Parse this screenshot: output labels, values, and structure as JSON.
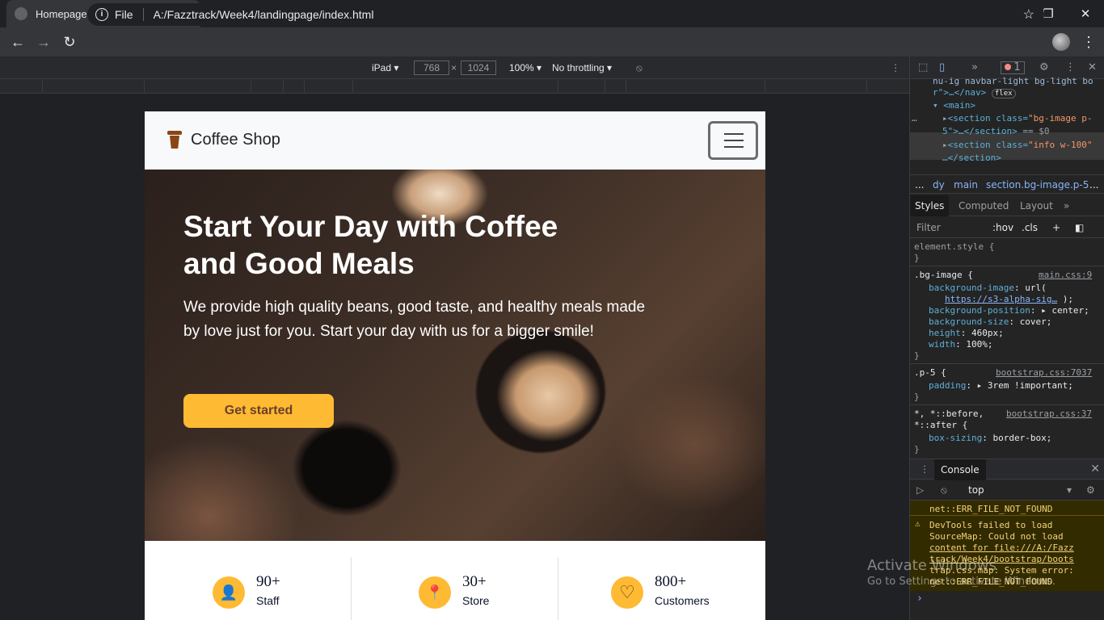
{
  "browser": {
    "tab_title": "Homepage",
    "tab_close": "✕",
    "new_tab": "+",
    "window_controls": [
      "—",
      "❐",
      "✕"
    ],
    "profile_dropdown": "▾",
    "file_label": "File",
    "url": "A:/Fazztrack/Week4/landingpage/index.html",
    "star": "☆",
    "menu": "⋮"
  },
  "device_toolbar": {
    "device": "iPad ▾",
    "width": "768",
    "times": "×",
    "height": "1024",
    "zoom": "100% ▾",
    "throttling": "No throttling ▾"
  },
  "site": {
    "brand": "Coffee Shop",
    "hero_title": "Start Your Day with Coffee and Good Meals",
    "hero_subtitle": "We provide high quality beans, good taste, and healthy meals made by love just for you. Start your day with us for a bigger smile!",
    "cta": "Get started",
    "stats": [
      {
        "icon": "person-icon",
        "glyph": "👤",
        "value": "90+",
        "label": "Staff"
      },
      {
        "icon": "location-pin-icon",
        "glyph": "📍",
        "value": "30+",
        "label": "Store"
      },
      {
        "icon": "heart-icon",
        "glyph": "♡",
        "value": "800+",
        "label": "Customers"
      }
    ],
    "accent": "#FFBA33",
    "brand_color": "#6A4029"
  },
  "devtools": {
    "error_count": "1",
    "elements": {
      "line1": "nu-ig navbar-light bg-light bo",
      "line2_a": "r\">…</nav>",
      "line2_badge": "flex",
      "line3": "<main>",
      "line4_a": "<section class=",
      "line4_b": "\"bg-image p-",
      "line5_a": "5\">…</section>",
      "line5_b": " == $0",
      "line6_a": "<section class=",
      "line6_b": "\"info w-100\"",
      "line7": "…</section>"
    },
    "breadcrumbs": [
      "...",
      "dy",
      "main",
      "section.bg-image.p-5",
      "..."
    ],
    "tabs": [
      "Styles",
      "Computed",
      "Layout",
      "»"
    ],
    "filter_placeholder": "Filter",
    "hov": ":hov",
    "cls": ".cls",
    "styles": {
      "element_style": "element.style {",
      "close": "}",
      "bg_selector": ".bg-image {",
      "bg_source": "main.css:9",
      "bg_image_prop": "background-image",
      "bg_image_val": ": url(",
      "bg_image_url": "https://s3-alpha-sig…",
      "bg_image_end": ");",
      "bg_pos_prop": "background-position",
      "bg_pos_val": ": ▸ center;",
      "bg_size_prop": "background-size",
      "bg_size_val": ": cover;",
      "height_prop": "height",
      "height_val": ": 460px;",
      "width_prop": "width",
      "width_val": ": 100%;",
      "p5_selector": ".p-5 {",
      "p5_source": "bootstrap.css:7037",
      "padding_prop": "padding",
      "padding_val": ": ▸ 3rem !important;",
      "univ_selector": "*, *::before,",
      "univ_selector2": "*::after {",
      "univ_source": "bootstrap.css:37",
      "box_prop": "box-sizing",
      "box_val": ": border-box;"
    },
    "console": {
      "tab": "Console",
      "context": "top",
      "err_tail": "net::ERR_FILE_NOT_FOUND",
      "warn_lines": [
        "DevTools failed to load",
        "SourceMap: Could not load",
        "content for file:///A:/Fazz",
        "track/Week4/bootstrap/boots",
        "trap.css.map: System error:",
        "net::ERR_FILE_NOT_FOUND"
      ],
      "prompt": "›"
    }
  },
  "os_watermark": {
    "line1": "Activate Windows",
    "line2": "Go to Settings to activate Windows."
  }
}
